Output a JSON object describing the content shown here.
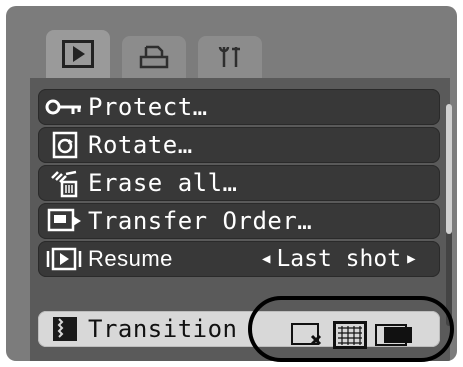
{
  "tabs": [
    {
      "icon": "play-icon",
      "active": true
    },
    {
      "icon": "print-icon",
      "active": false
    },
    {
      "icon": "setup-tools-icon",
      "active": false
    }
  ],
  "menu": {
    "items": [
      {
        "icon": "key-icon",
        "label": "Protect…"
      },
      {
        "icon": "rotate-icon",
        "label": "Rotate…"
      },
      {
        "icon": "erase-all-icon",
        "label": "Erase all…"
      },
      {
        "icon": "transfer-order-icon",
        "label": "Transfer Order…"
      },
      {
        "icon": "resume-icon",
        "label": "Resume",
        "value": "Last shot"
      },
      {
        "icon": "transition-icon",
        "label": "Transition",
        "selected": true
      }
    ]
  },
  "transition_options": [
    {
      "icon": "transition-off-icon"
    },
    {
      "icon": "transition-fade-icon",
      "selected": true
    },
    {
      "icon": "transition-slide-icon"
    }
  ],
  "colors": {
    "background": "#7c7c7c",
    "row": "#383838",
    "selected_row": "#d8d8d8"
  }
}
